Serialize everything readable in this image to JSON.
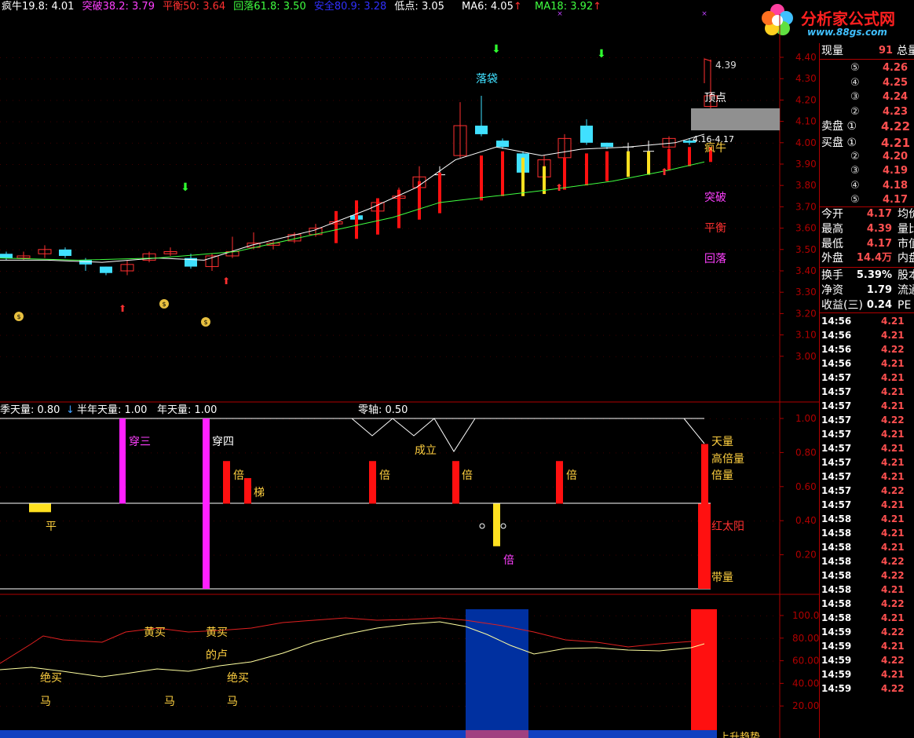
{
  "header": {
    "items": [
      {
        "label": "疯牛19.8:",
        "value": "4.01",
        "label_color": "#ffffff",
        "value_color": "#ffffff"
      },
      {
        "label": "突破38.2:",
        "value": "3.79",
        "label_color": "#ff40ff",
        "value_color": "#ff40ff"
      },
      {
        "label": "平衡50:",
        "value": "3.64",
        "label_color": "#ff3030",
        "value_color": "#ff3030"
      },
      {
        "label": "回落61.8:",
        "value": "3.50",
        "label_color": "#40ff40",
        "value_color": "#40ff40"
      },
      {
        "label": "安全80.9:",
        "value": "3.28",
        "label_color": "#3030ff",
        "value_color": "#3030ff"
      },
      {
        "label": "低点:",
        "value": "3.05",
        "label_color": "#ffffff",
        "value_color": "#ffffff"
      }
    ],
    "ma6_label": "MA6:",
    "ma6_value": "4.05",
    "ma18_label": "MA18:",
    "ma18_value": "3.92"
  },
  "logo": {
    "title": "分析家公式网",
    "url": "www.88gs.com"
  },
  "price_axis": [
    "4.40",
    "4.30",
    "4.20",
    "4.10",
    "4.00",
    "3.90",
    "3.80",
    "3.70",
    "3.60",
    "3.50",
    "3.40",
    "3.30",
    "3.20",
    "3.10",
    "3.00"
  ],
  "main_annotations": {
    "luodai": "落袋",
    "peak_price": "4.39",
    "dingdian": "顶点",
    "range": "4.16-4.17",
    "fengniu": "疯牛",
    "tupo": "突破",
    "pingheng": "平衡",
    "huiluo": "回落"
  },
  "vol_header": {
    "q": "季天量: 0.80",
    "h": "半年天量: 1.00",
    "y": "年天量: 1.00",
    "zero": "零轴: 0.50"
  },
  "vol_axis": [
    "1.00",
    "0.80",
    "0.60",
    "0.40",
    "0.20"
  ],
  "vol_annotations": {
    "chuansan": "穿三",
    "chuansi": "穿四",
    "ping": "平",
    "bei": "倍",
    "ti": "梯",
    "chengli": "成立",
    "tianliang": "天量",
    "gaobeiliang": "高倍量",
    "beiliang": "倍量",
    "hongtaiyang": "红太阳",
    "dailiang": "带量"
  },
  "osc_axis": [
    "100.0",
    "80.00",
    "60.00",
    "40.00",
    "20.00"
  ],
  "osc_annotations": {
    "huangmai": "黄买",
    "huangmai2": "黄买",
    "dedian": "的卢",
    "juemai": "绝买",
    "juemai2": "绝买",
    "ma": "马",
    "shangsheng": "上升趋势"
  },
  "quote": {
    "xianliang_label": "现量",
    "xianliang_value": "91",
    "zongliang_label": "总量",
    "sell": [
      {
        "lvl": "⑤",
        "price": "4.26"
      },
      {
        "lvl": "④",
        "price": "4.25"
      },
      {
        "lvl": "③",
        "price": "4.24"
      },
      {
        "lvl": "②",
        "price": "4.23"
      },
      {
        "lvl": "卖盘 ①",
        "price": "4.22"
      }
    ],
    "buy": [
      {
        "lvl": "买盘 ①",
        "price": "4.21"
      },
      {
        "lvl": "②",
        "price": "4.20"
      },
      {
        "lvl": "③",
        "price": "4.19"
      },
      {
        "lvl": "④",
        "price": "4.18"
      },
      {
        "lvl": "⑤",
        "price": "4.17"
      }
    ],
    "stats": [
      {
        "k": "今开",
        "v": "4.17",
        "k2": "均价"
      },
      {
        "k": "最高",
        "v": "4.39",
        "k2": "量比"
      },
      {
        "k": "最低",
        "v": "4.17",
        "k2": "市值"
      },
      {
        "k": "外盘",
        "v": "14.4万",
        "k2": "内盘"
      }
    ],
    "stats2": [
      {
        "k": "换手",
        "v": "5.39%",
        "k2": "股本"
      },
      {
        "k": "净资",
        "v": "1.79",
        "k2": "流通"
      },
      {
        "k": "收益(三)",
        "v": "0.24",
        "k2": "PE"
      }
    ]
  },
  "ticks": [
    {
      "t": "14:56",
      "p": "4.21"
    },
    {
      "t": "14:56",
      "p": "4.21"
    },
    {
      "t": "14:56",
      "p": "4.22"
    },
    {
      "t": "14:56",
      "p": "4.21"
    },
    {
      "t": "14:57",
      "p": "4.21"
    },
    {
      "t": "14:57",
      "p": "4.21"
    },
    {
      "t": "14:57",
      "p": "4.21"
    },
    {
      "t": "14:57",
      "p": "4.22"
    },
    {
      "t": "14:57",
      "p": "4.21"
    },
    {
      "t": "14:57",
      "p": "4.21"
    },
    {
      "t": "14:57",
      "p": "4.21"
    },
    {
      "t": "14:57",
      "p": "4.21"
    },
    {
      "t": "14:57",
      "p": "4.22"
    },
    {
      "t": "14:57",
      "p": "4.21"
    },
    {
      "t": "14:58",
      "p": "4.21"
    },
    {
      "t": "14:58",
      "p": "4.21"
    },
    {
      "t": "14:58",
      "p": "4.21"
    },
    {
      "t": "14:58",
      "p": "4.22"
    },
    {
      "t": "14:58",
      "p": "4.22"
    },
    {
      "t": "14:58",
      "p": "4.21"
    },
    {
      "t": "14:58",
      "p": "4.22"
    },
    {
      "t": "14:58",
      "p": "4.21"
    },
    {
      "t": "14:59",
      "p": "4.22"
    },
    {
      "t": "14:59",
      "p": "4.21"
    },
    {
      "t": "14:59",
      "p": "4.22"
    },
    {
      "t": "14:59",
      "p": "4.21"
    },
    {
      "t": "14:59",
      "p": "4.22"
    }
  ]
}
